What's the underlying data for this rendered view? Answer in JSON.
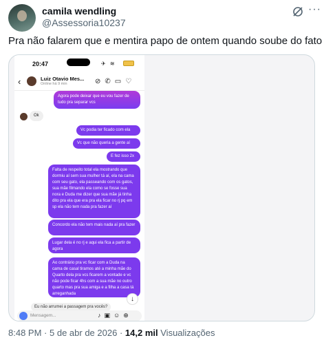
{
  "author": {
    "name": "camila wendling",
    "handle": "@Assessoria10237"
  },
  "tweet": {
    "text": "Pra não falarem que e mentira papo de ontem quando soube do fato"
  },
  "phone": {
    "time": "20:47",
    "contact_name": "Luiz Otavio Mes...",
    "contact_status": "Online há 9 min",
    "messages": [
      {
        "dir": "out",
        "text": "Agora pode deixar que eu vou fazer de tudo pra separar vcs"
      },
      {
        "dir": "in",
        "text": "Ok"
      },
      {
        "dir": "out",
        "text": "Vc podia ter ficado com ela"
      },
      {
        "dir": "out",
        "text": "Vc que não queria a gente aí"
      },
      {
        "dir": "out",
        "text": "E fez isso 2x"
      },
      {
        "dir": "out",
        "text": "Falta de respeito total ela mostrando que dormiu aí sem sua mulher tá aí, ela na cama com seu gato, ela passeando com os gatos, sua mãe filmando ela como se fosse sua nora e Duda me dizer que sua mãe já tinha dito pra ela que era pra ela ficar no rj pq em sp ela não tem nada pra fazer aí"
      },
      {
        "dir": "out",
        "text": "Concordo ela não tem mais nada aí pra fazer"
      },
      {
        "dir": "out",
        "text": "Lugar dela é no rj e aqui ela fica a partir de agora"
      },
      {
        "dir": "out",
        "text": "Ao contrário pra vc ficar com a Duda na cama de casal tiramos até a minha mãe do Quarto dela pra vcs ficarem a vontade e vc não pode ficar 4hs com a sua mãe no outro quarto mas pra sua amiga e a filha a casa tá arreganhada"
      }
    ],
    "reply_question": "Eu não arrumei a passagem pra vocês?",
    "composer_placeholder": "Mensagem..."
  },
  "meta": {
    "time": "8:48 PM",
    "separator": "·",
    "date": "5 de abr de 2026",
    "views_count": "14,2 mil",
    "views_label": "Visualizações"
  },
  "icons": [
    "grok-icon",
    "more-icon",
    "back-icon",
    "phone-call-icon",
    "video-call-icon",
    "camera-icon",
    "mic-icon",
    "gallery-icon",
    "sticker-icon",
    "plus-icon"
  ]
}
